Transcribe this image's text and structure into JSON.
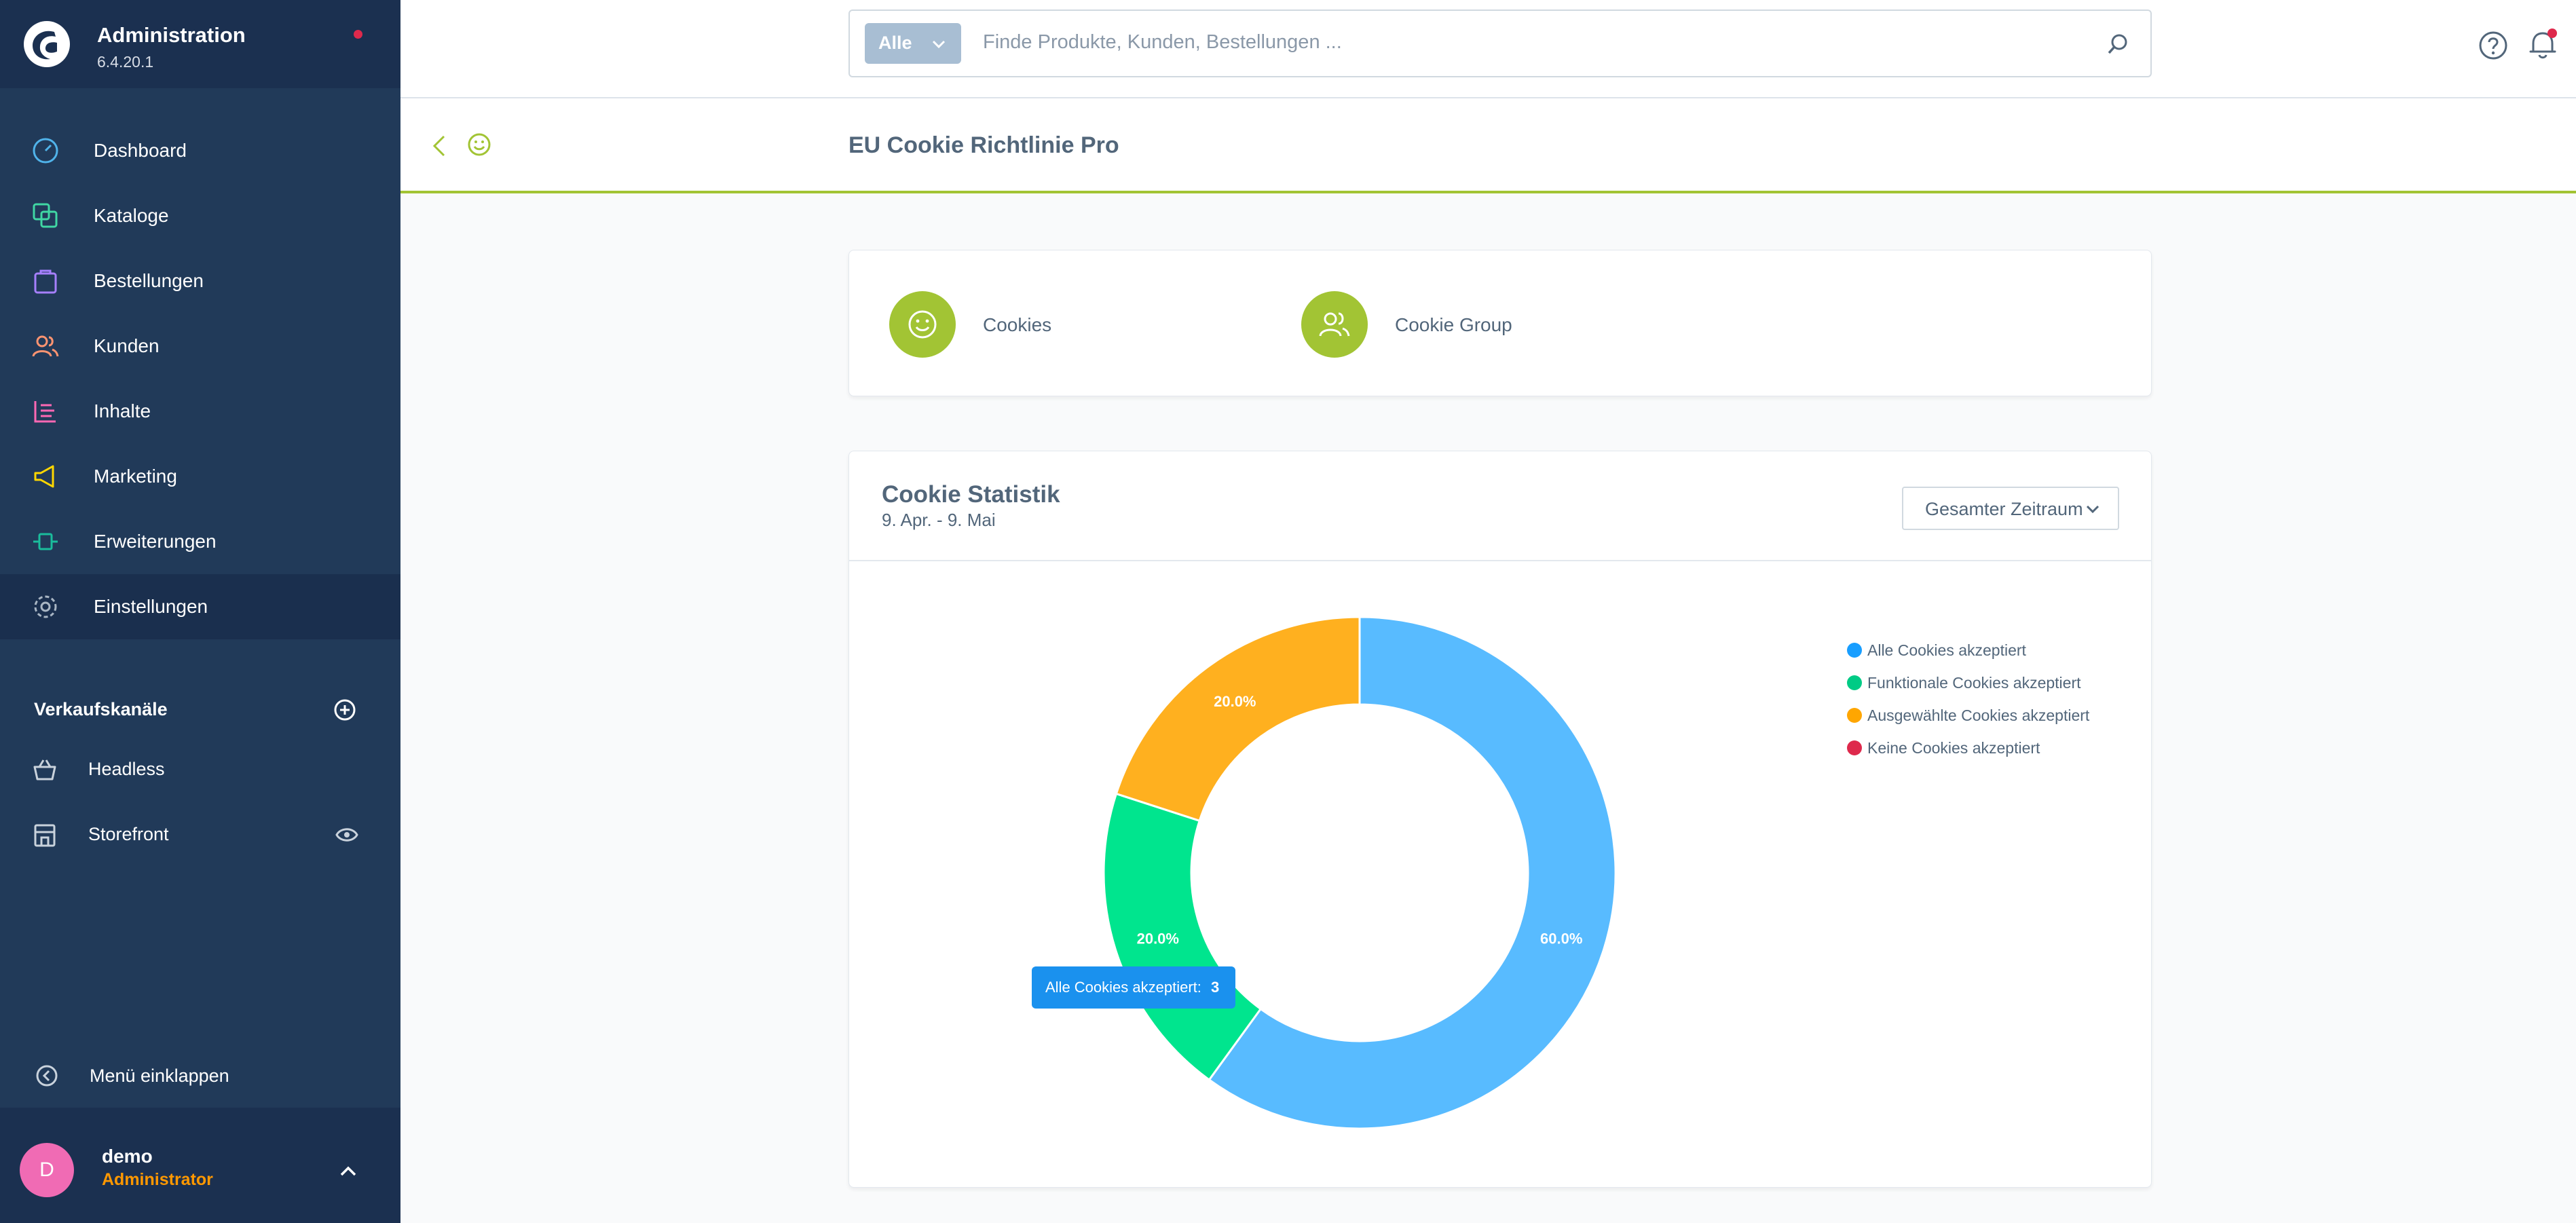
{
  "app": {
    "title": "Administration",
    "version": "6.4.20.1"
  },
  "nav": {
    "items": [
      {
        "label": "Dashboard",
        "icon": "dashboard-icon",
        "color": "#50b3ea"
      },
      {
        "label": "Kataloge",
        "icon": "catalog-icon",
        "color": "#40d7a4"
      },
      {
        "label": "Bestellungen",
        "icon": "orders-icon",
        "color": "#a680ff"
      },
      {
        "label": "Kunden",
        "icon": "customers-icon",
        "color": "#ff9471"
      },
      {
        "label": "Inhalte",
        "icon": "content-icon",
        "color": "#ff68b4"
      },
      {
        "label": "Marketing",
        "icon": "marketing-icon",
        "color": "#ffd700"
      },
      {
        "label": "Erweiterungen",
        "icon": "extensions-icon",
        "color": "#1abc9c"
      },
      {
        "label": "Einstellungen",
        "icon": "settings-icon",
        "color": "#a9b6c4"
      }
    ],
    "active": "Einstellungen"
  },
  "sales_channels": {
    "title": "Verkaufskanäle",
    "items": [
      {
        "label": "Headless"
      },
      {
        "label": "Storefront"
      }
    ]
  },
  "collapse_label": "Menü einklappen",
  "user": {
    "initial": "D",
    "name": "demo",
    "role": "Administrator"
  },
  "search": {
    "filter": "Alle",
    "placeholder": "Finde Produkte, Kunden, Bestellungen ..."
  },
  "page": {
    "title": "EU Cookie Richtlinie Pro"
  },
  "tiles": [
    {
      "label": "Cookies"
    },
    {
      "label": "Cookie Group"
    }
  ],
  "stats": {
    "title": "Cookie Statistik",
    "range": "9. Apr. - 9. Mai",
    "period": "Gesamter Zeitraum",
    "tooltip": {
      "label": "Alle Cookies akzeptiert:",
      "value": "3"
    }
  },
  "chart_data": {
    "type": "pie",
    "categories": [
      "Alle Cookies akzeptiert",
      "Funktionale Cookies akzeptiert",
      "Ausgewählte Cookies akzeptiert",
      "Keine Cookies akzeptiert"
    ],
    "values": [
      60.0,
      20.0,
      20.0,
      0.0
    ],
    "labels": [
      "60.0%",
      "20.0%",
      "20.0%",
      ""
    ],
    "colors": [
      "#189eff",
      "#00cb85",
      "#ffa600",
      "#de294c"
    ],
    "slice_colors": [
      "#58bbff",
      "#00e58e",
      "#ffb01f",
      "#de294c"
    ],
    "legend": "top-right",
    "donut": true
  }
}
